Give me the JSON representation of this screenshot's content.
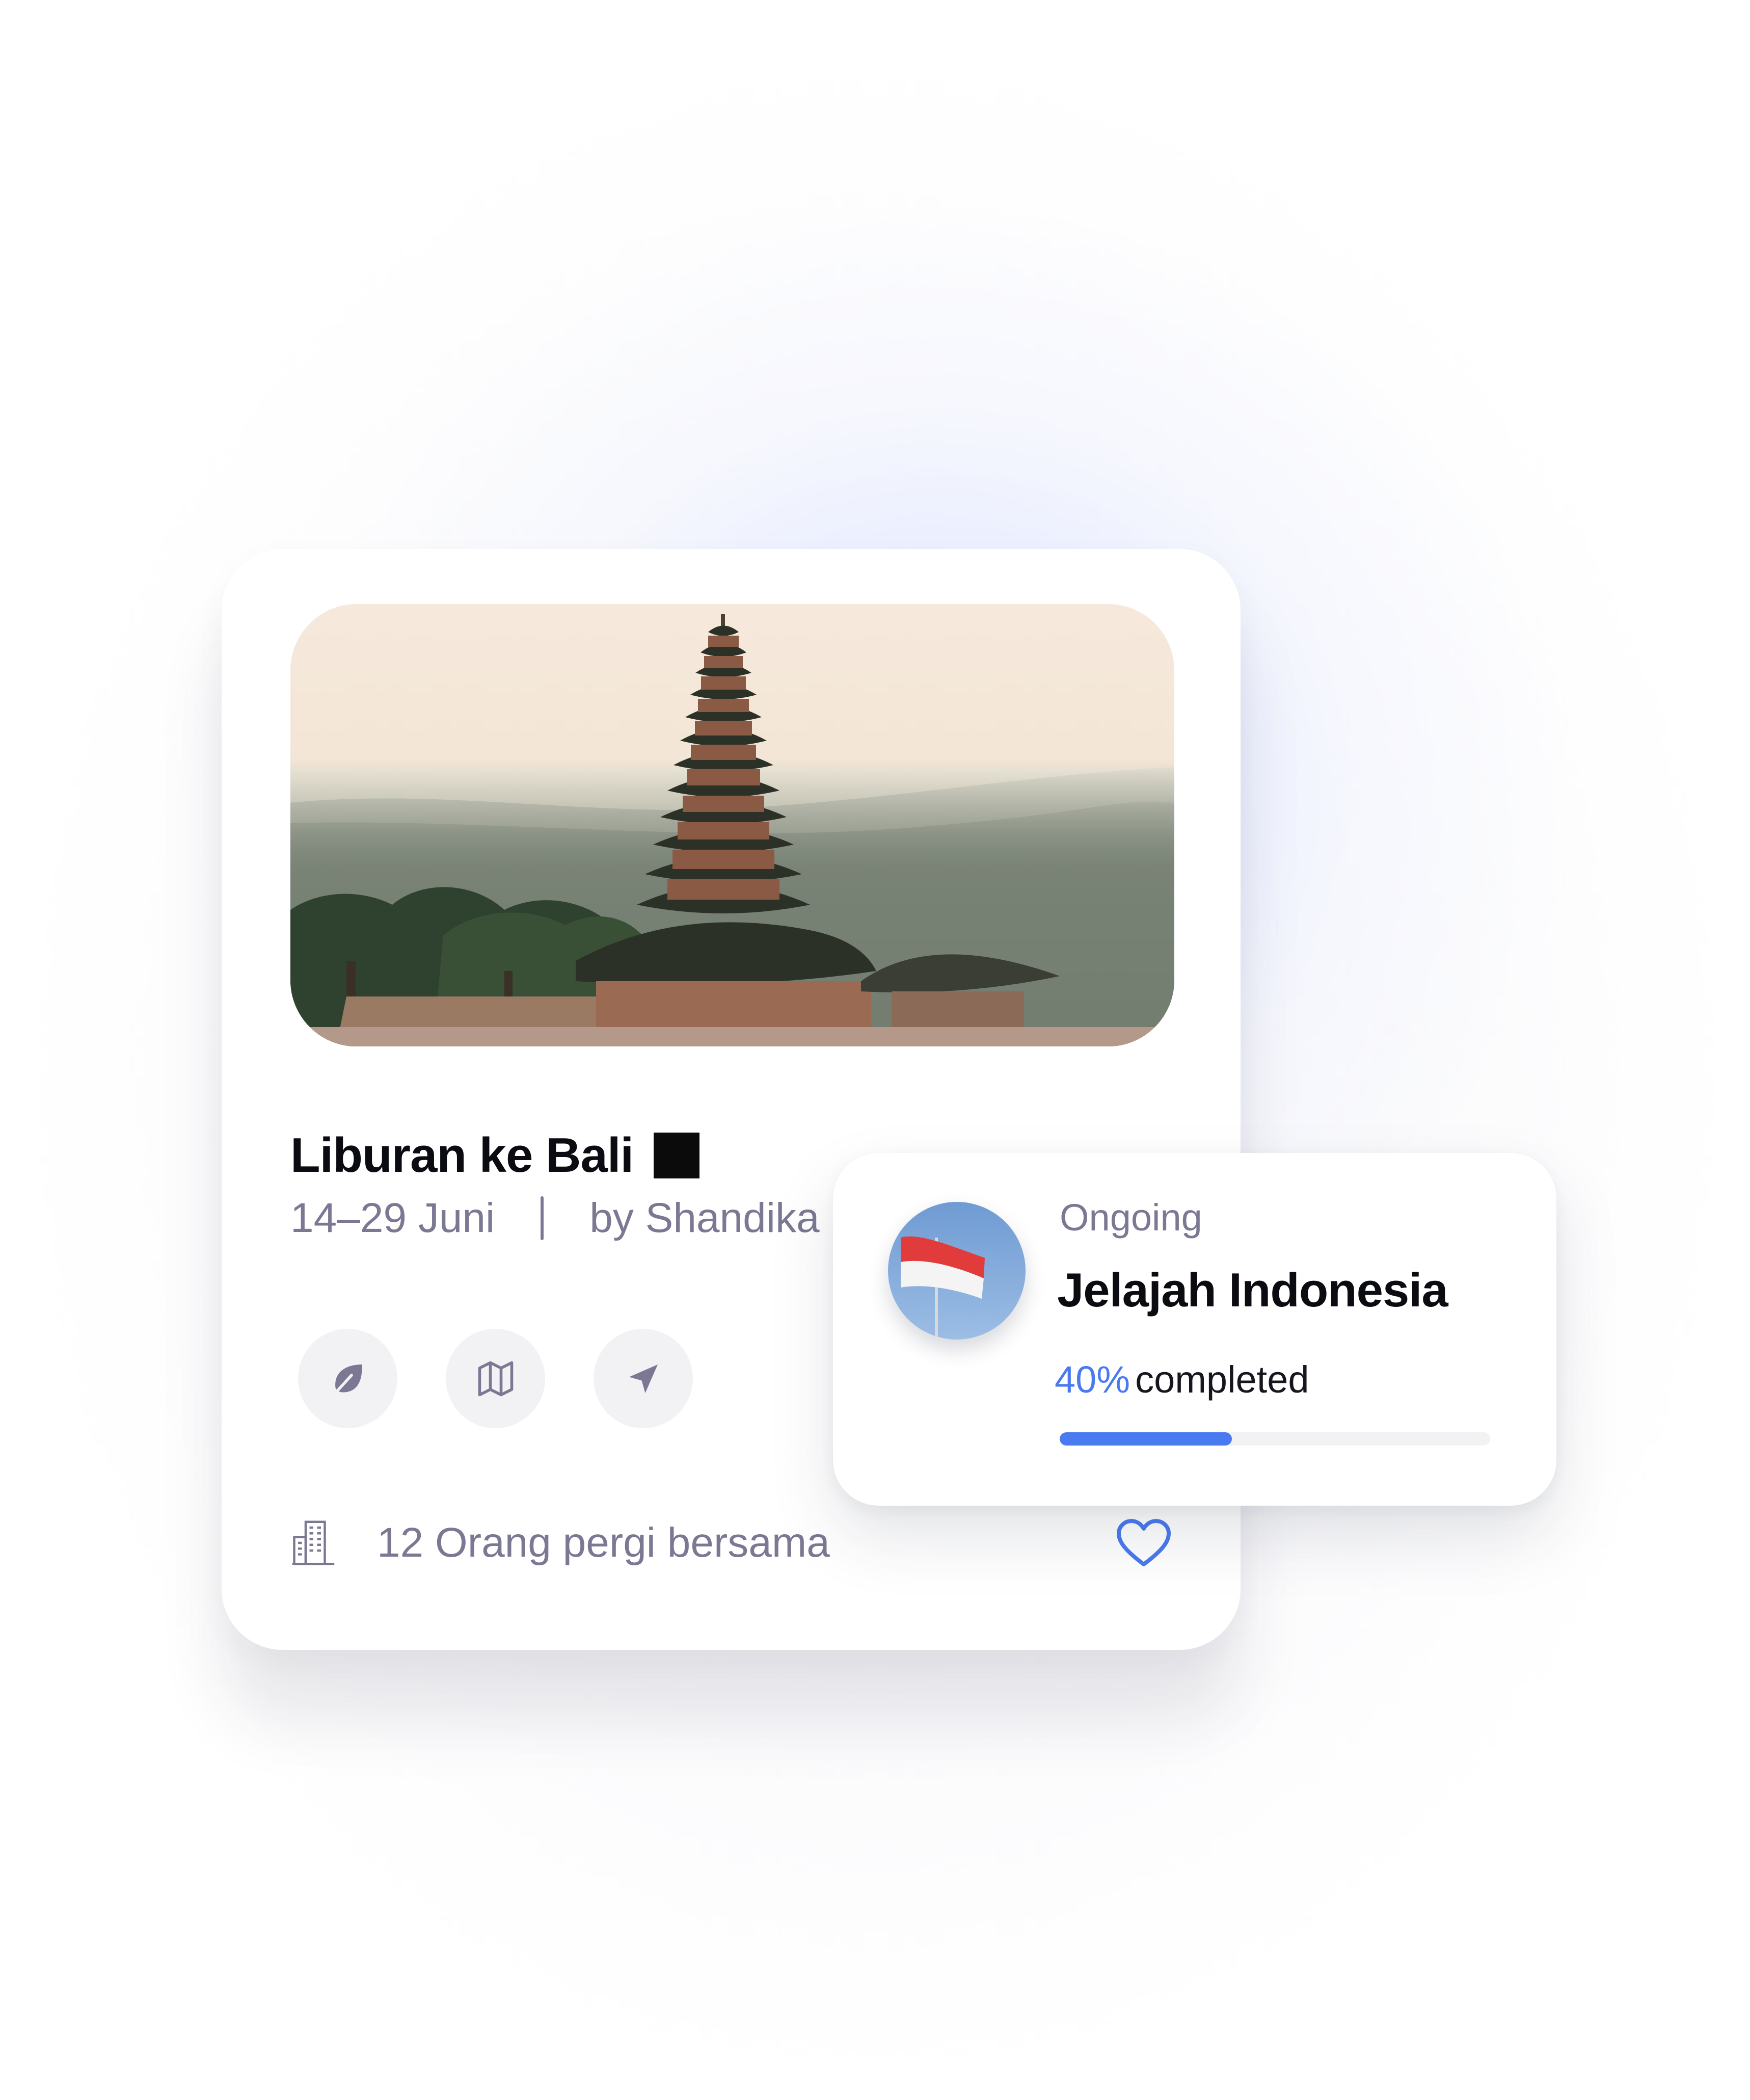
{
  "trip_card": {
    "title": "Liburan ke Bali",
    "date_range": "14–29 Juni",
    "author": "by Shandika",
    "people_text": "12 Orang pergi bersama",
    "action_icons": [
      "leaf-icon",
      "map-icon",
      "send-icon"
    ],
    "favorite_icon": "heart-icon"
  },
  "progress_card": {
    "status": "Ongoing",
    "title": "Jelajah Indonesia",
    "percent_label": "40%",
    "completed_label": "completed",
    "progress": 0.4,
    "accent_color": "#4A7AF0"
  },
  "colors": {
    "muted_text": "#7A7893",
    "title_text": "#0B0B12",
    "icon_bg": "#F2F2F4"
  }
}
